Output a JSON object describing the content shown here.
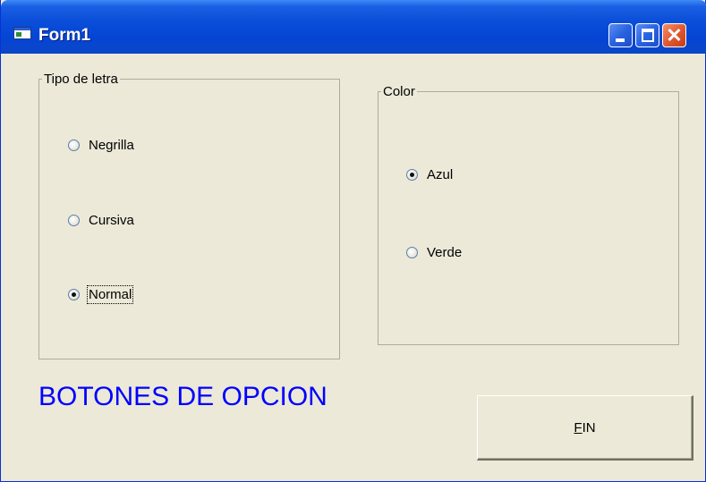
{
  "window": {
    "title": "Form1"
  },
  "groups": {
    "font": {
      "legend": "Tipo de letra",
      "options": [
        {
          "label": "Negrilla",
          "checked": false
        },
        {
          "label": "Cursiva",
          "checked": false
        },
        {
          "label": "Normal",
          "checked": true,
          "focused": true
        }
      ]
    },
    "color": {
      "legend": "Color",
      "options": [
        {
          "label": "Azul",
          "checked": true
        },
        {
          "label": "Verde",
          "checked": false
        }
      ]
    }
  },
  "banner": {
    "text": "BOTONES DE OPCION",
    "color": "#0000ff"
  },
  "fin_button": {
    "mnemonic": "F",
    "rest": "IN"
  },
  "icons": {
    "app": "form-icon",
    "minimize": "minimize-icon",
    "maximize": "maximize-icon",
    "close": "close-icon"
  }
}
